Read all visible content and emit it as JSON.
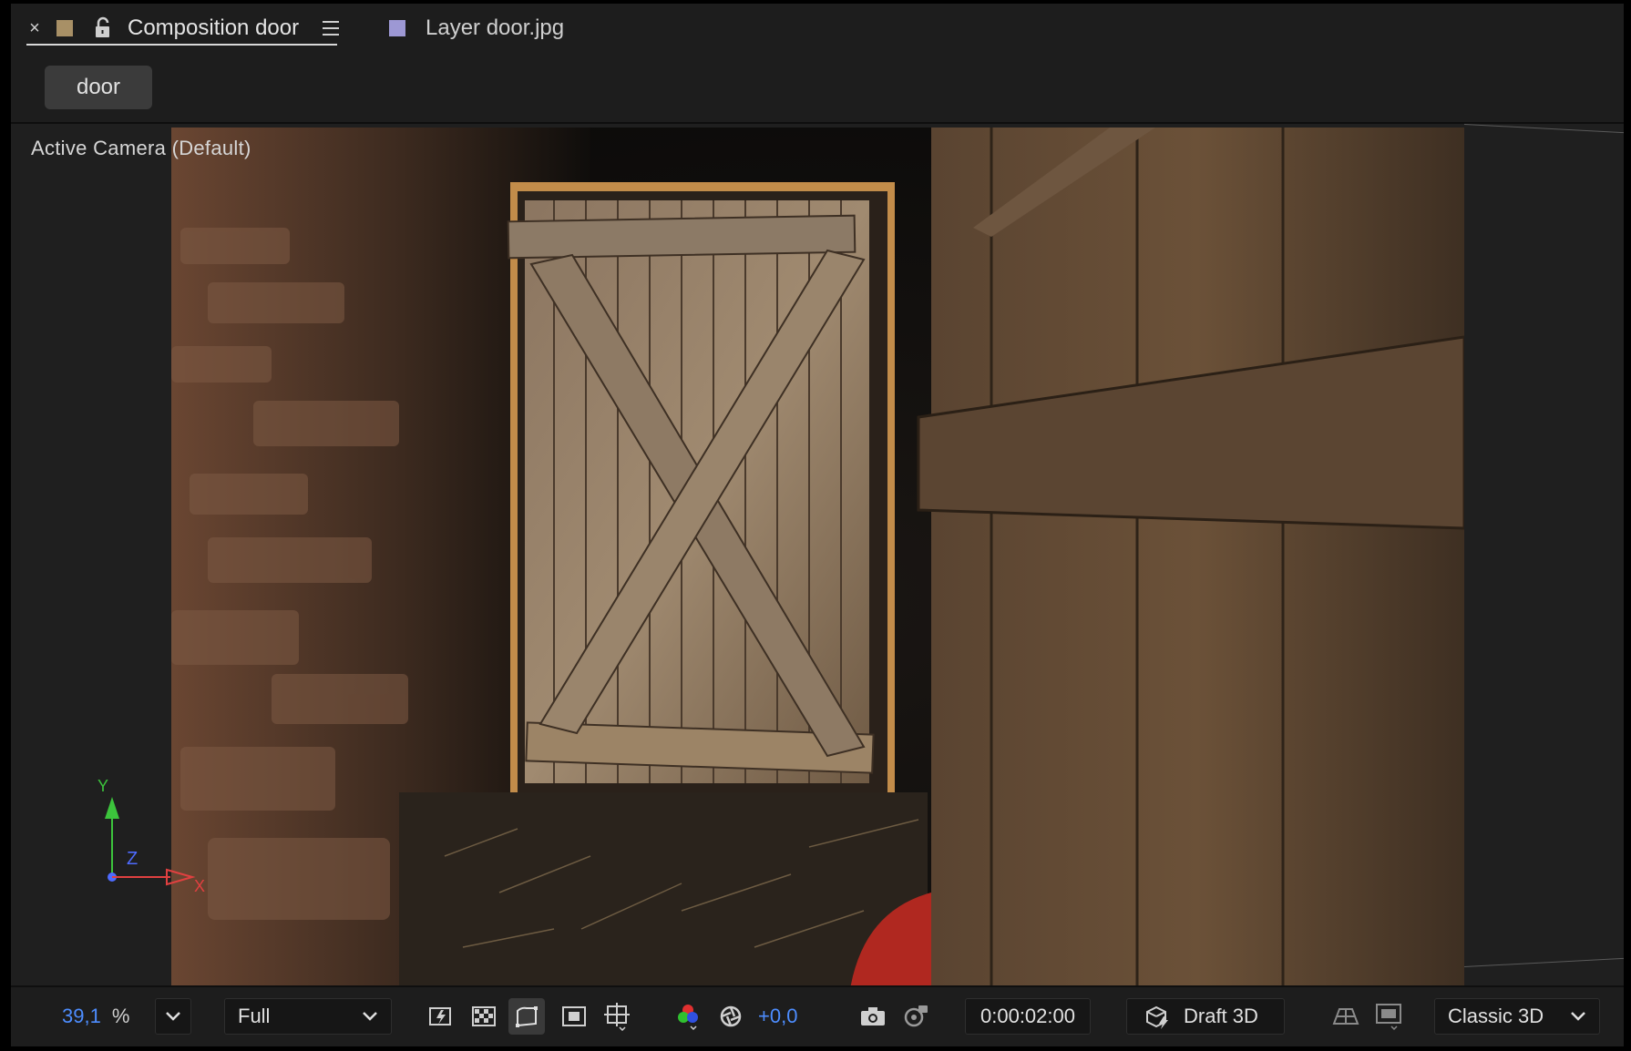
{
  "tabs": {
    "composition": {
      "close": "×",
      "label": "Composition door",
      "swatch_color": "#a89066"
    },
    "layer": {
      "label": "Layer door.jpg",
      "swatch_color": "#9d98d4"
    }
  },
  "breadcrumb": {
    "label": "door"
  },
  "viewer": {
    "camera_label": "Active Camera (Default)"
  },
  "axes": {
    "y": "Y",
    "z": "Z",
    "x": "X"
  },
  "toolbar": {
    "zoom_value": "39,1",
    "zoom_unit": "%",
    "resolution": "Full",
    "exposure": "+0,0",
    "timecode": "0:00:02:00",
    "draft_3d": "Draft 3D",
    "renderer": "Classic 3D"
  },
  "colors": {
    "accent_blue": "#4d8dff",
    "panel_bg": "#1d1d1d"
  }
}
